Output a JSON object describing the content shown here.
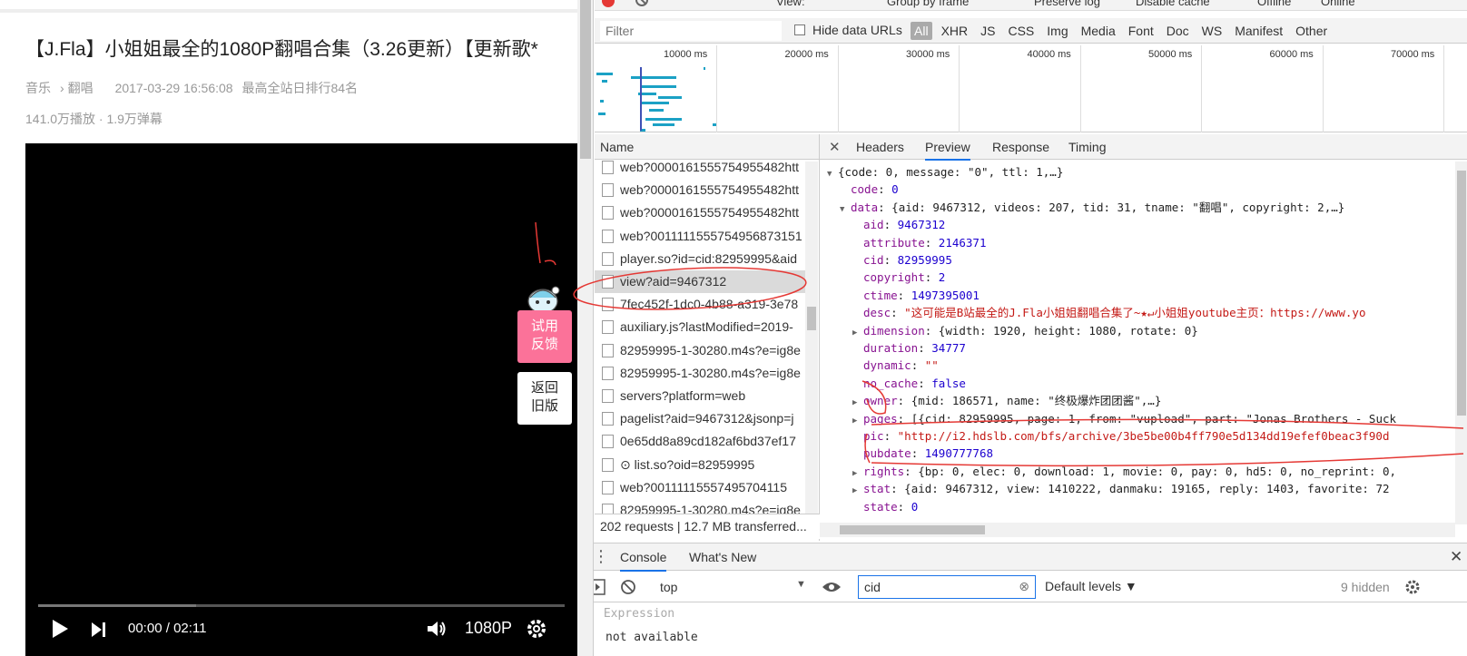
{
  "video": {
    "title": "【J.Fla】小姐姐最全的1080P翻唱合集（3.26更新）【更新歌*",
    "category": "音乐",
    "subcategory": "翻唱",
    "date": "2017-03-29 16:56:08",
    "rank": "最高全站日排行84名",
    "stats": "141.0万播放 · 1.9万弹幕",
    "time_current": "00:00",
    "time_sep": "/",
    "time_total": "02:11",
    "quality": "1080P",
    "progress": 0.3
  },
  "side_buttons": {
    "feedback": [
      "试用",
      "反馈"
    ],
    "old": [
      "返回",
      "旧版"
    ]
  },
  "devtools": {
    "toolbar_partial": [
      "View:",
      "Group by frame",
      "Preserve log",
      "Disable cache",
      "Offline",
      "Online"
    ],
    "filter_placeholder": "Filter",
    "hide_data_urls": "Hide data URLs",
    "type_filters": [
      "All",
      "XHR",
      "JS",
      "CSS",
      "Img",
      "Media",
      "Font",
      "Doc",
      "WS",
      "Manifest",
      "Other"
    ],
    "timeline_ticks": [
      "10000 ms",
      "20000 ms",
      "30000 ms",
      "40000 ms",
      "50000 ms",
      "60000 ms",
      "70000 ms"
    ],
    "name_header": "Name",
    "requests": [
      "web?00001615557549554​82htt",
      "web?00001615557549554​82htt",
      "web?00001615557549554​82htt",
      "web?0011111555754956873151",
      "player.so?id=cid:82959995&aid",
      "view?aid=9467312",
      "7fec452f-1dc0-4b88-a319-3e78",
      "auxiliary.js?lastModified=2019-",
      "82959995-1-30280.m4s?e=ig8e",
      "82959995-1-30280.m4s?e=ig8e",
      "servers?platform=web",
      "pagelist?aid=9467312&jsonp=j",
      "0e65dd8a89cd182af6bd37ef17",
      "⊙ list.so?oid=82959995",
      "web?0011111555749570411​5",
      "82959995-1-30280.m4s?e=ig8e"
    ],
    "footer": "202 requests  |  12.7 MB transferred...",
    "preview_tabs": [
      "Headers",
      "Preview",
      "Response",
      "Timing"
    ],
    "json_lines": [
      {
        "ind": 0,
        "tri": "▼",
        "k": "",
        "v": "{code: 0, message: \"0\", ttl: 1,…}",
        "c": "p"
      },
      {
        "ind": 1,
        "tri": "",
        "k": "code",
        "v": "0",
        "c": "n"
      },
      {
        "ind": 1,
        "tri": "▼",
        "k": "data",
        "v": "{aid: 9467312, videos: 207, tid: 31, tname: \"翻唱\", copyright: 2,…}",
        "c": "p"
      },
      {
        "ind": 2,
        "tri": "",
        "k": "aid",
        "v": "9467312",
        "c": "n"
      },
      {
        "ind": 2,
        "tri": "",
        "k": "attribute",
        "v": "2146371",
        "c": "n"
      },
      {
        "ind": 2,
        "tri": "",
        "k": "cid",
        "v": "82959995",
        "c": "n"
      },
      {
        "ind": 2,
        "tri": "",
        "k": "copyright",
        "v": "2",
        "c": "n"
      },
      {
        "ind": 2,
        "tri": "",
        "k": "ctime",
        "v": "1497395001",
        "c": "n"
      },
      {
        "ind": 2,
        "tri": "",
        "k": "desc",
        "v": "\"这可能是B站最全的J.Fla小姐姐翻唱合集了~★↵小姐姐youtube主页：https://www.yo",
        "c": "s"
      },
      {
        "ind": 2,
        "tri": "▶",
        "k": "dimension",
        "v": "{width: 1920, height: 1080, rotate: 0}",
        "c": "p"
      },
      {
        "ind": 2,
        "tri": "",
        "k": "duration",
        "v": "34777",
        "c": "n"
      },
      {
        "ind": 2,
        "tri": "",
        "k": "dynamic",
        "v": "\"\"",
        "c": "s"
      },
      {
        "ind": 2,
        "tri": "",
        "k": "no_cache",
        "v": "false",
        "c": "n"
      },
      {
        "ind": 2,
        "tri": "▶",
        "k": "owner",
        "v": "{mid: 186571, name: \"终极爆炸团团酱\",…}",
        "c": "p"
      },
      {
        "ind": 2,
        "tri": "▶",
        "k": "pages",
        "v": "[{cid: 82959995, page: 1, from: \"vupload\", part: \"Jonas Brothers - Suck",
        "c": "p"
      },
      {
        "ind": 2,
        "tri": "",
        "k": "pic",
        "v": "\"http://i2.hdslb.com/bfs/archive/3be5be00b4ff790e5d134dd19efef0beac3f90d",
        "c": "s"
      },
      {
        "ind": 2,
        "tri": "",
        "k": "pubdate",
        "v": "1490777768",
        "c": "n"
      },
      {
        "ind": 2,
        "tri": "▶",
        "k": "rights",
        "v": "{bp: 0, elec: 0, download: 1, movie: 0, pay: 0, hd5: 0, no_reprint: 0,",
        "c": "p"
      },
      {
        "ind": 2,
        "tri": "▶",
        "k": "stat",
        "v": "{aid: 9467312, view: 1410222, danmaku: 19165, reply: 1403, favorite: 72",
        "c": "p"
      },
      {
        "ind": 2,
        "tri": "",
        "k": "state",
        "v": "0",
        "c": "n"
      }
    ],
    "drawer_tabs": [
      "Console",
      "What's New"
    ],
    "context": "top",
    "console_filter": "cid",
    "levels": "Default levels ▼",
    "hidden": "9 hidden",
    "expression": "Expression",
    "expression_value": "not available"
  }
}
